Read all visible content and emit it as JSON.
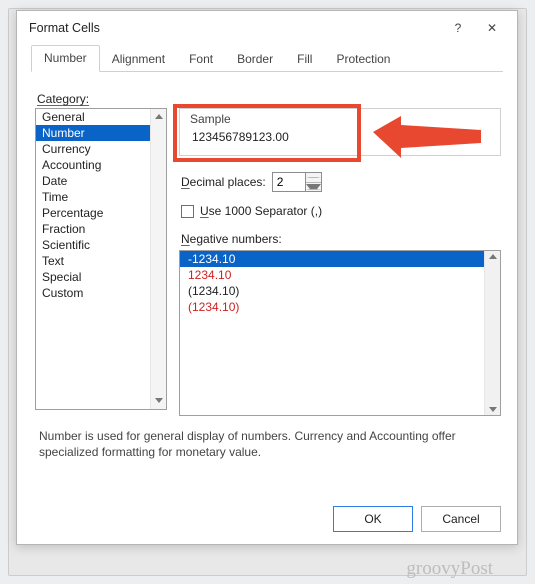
{
  "window": {
    "title": "Format Cells",
    "help_icon": "?",
    "close_icon": "✕"
  },
  "tabs": {
    "items": [
      "Number",
      "Alignment",
      "Font",
      "Border",
      "Fill",
      "Protection"
    ],
    "active_index": 0
  },
  "category": {
    "label": "Category:",
    "items": [
      "General",
      "Number",
      "Currency",
      "Accounting",
      "Date",
      "Time",
      "Percentage",
      "Fraction",
      "Scientific",
      "Text",
      "Special",
      "Custom"
    ],
    "selected_index": 1
  },
  "sample": {
    "label": "Sample",
    "value": "123456789123.00"
  },
  "decimal": {
    "label_pre": "D",
    "label_rest": "ecimal places:",
    "value": "2"
  },
  "separator": {
    "label_pre": "U",
    "label_rest": "se 1000 Separator (,)",
    "checked": false
  },
  "negative": {
    "label_pre": "N",
    "label_rest": "egative numbers:",
    "items": [
      {
        "text": "-1234.10",
        "style": "sel"
      },
      {
        "text": "1234.10",
        "style": "red"
      },
      {
        "text": "(1234.10)",
        "style": ""
      },
      {
        "text": "(1234.10)",
        "style": "red"
      }
    ],
    "selected_index": 0
  },
  "description": "Number is used for general display of numbers.  Currency and Accounting offer specialized formatting for monetary value.",
  "buttons": {
    "ok": "OK",
    "cancel": "Cancel"
  },
  "watermark": "groovyPost"
}
